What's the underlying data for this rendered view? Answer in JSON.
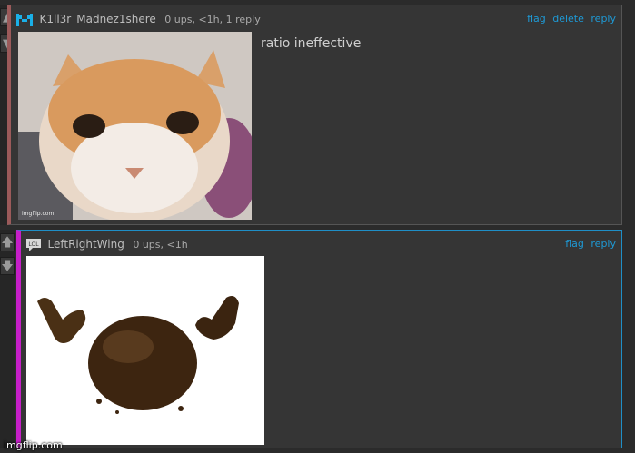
{
  "comments": [
    {
      "username": "K1ll3r_Madnez1shere",
      "meta": "0 ups, <1h, 1 reply",
      "text": "ratio ineffective",
      "actions": [
        "flag",
        "delete",
        "reply"
      ],
      "image_mark": "imgflip.com",
      "avatar": "pixel-logo-icon",
      "accent": "#9b5a5a"
    },
    {
      "username": "LeftRightWing",
      "meta": "0 ups, <1h",
      "avatar_label": "LOL",
      "actions": [
        "flag",
        "reply"
      ],
      "accent": "#c61ec8"
    }
  ],
  "watermark": "imgflip.com",
  "colors": {
    "link": "#1e9ad6",
    "background": "#2b2b2b",
    "panel": "#353535",
    "border_active": "#1f8fc7"
  }
}
